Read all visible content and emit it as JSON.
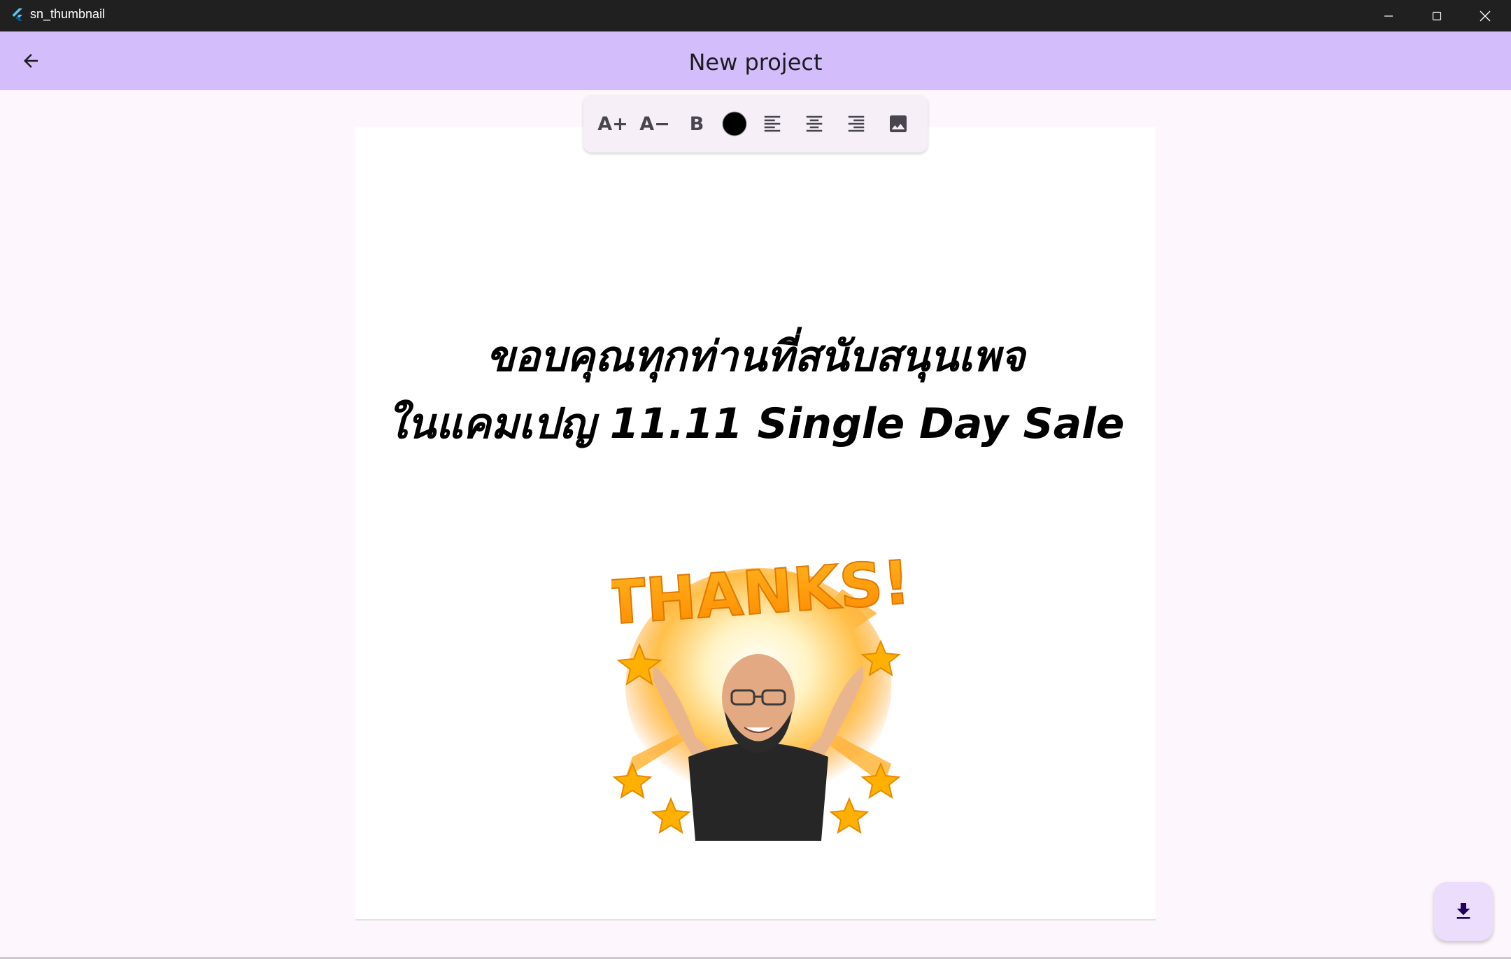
{
  "window": {
    "title": "sn_thumbnail",
    "app_icon": "flutter-icon",
    "controls": [
      "minimize-icon",
      "maximize-icon",
      "close-icon"
    ]
  },
  "appbar": {
    "title": "New project",
    "back_icon": "arrow-back-icon",
    "color": "#d3bdfa"
  },
  "toolbar": {
    "items": [
      {
        "label": "A+",
        "icon": "font-size-increase-icon"
      },
      {
        "label": "A−",
        "icon": "font-size-decrease-icon"
      },
      {
        "label": "B",
        "icon": "bold-icon"
      },
      {
        "label": "",
        "icon": "text-color-icon",
        "color": "#000000"
      },
      {
        "label": "",
        "icon": "align-left-icon"
      },
      {
        "label": "",
        "icon": "align-center-icon"
      },
      {
        "label": "",
        "icon": "align-right-icon"
      },
      {
        "label": "",
        "icon": "image-icon"
      }
    ]
  },
  "canvas": {
    "headline_line1": "ขอบคุณทุกท่านที่สนับสนุนเพจ",
    "headline_line2": "ในแคมเปญ 11.11 Single Day Sale",
    "sticker_text": "THANKS!",
    "sticker_icon": "thanks-sticker-image"
  },
  "fab": {
    "icon": "download-icon",
    "color": "#ebddfb"
  }
}
